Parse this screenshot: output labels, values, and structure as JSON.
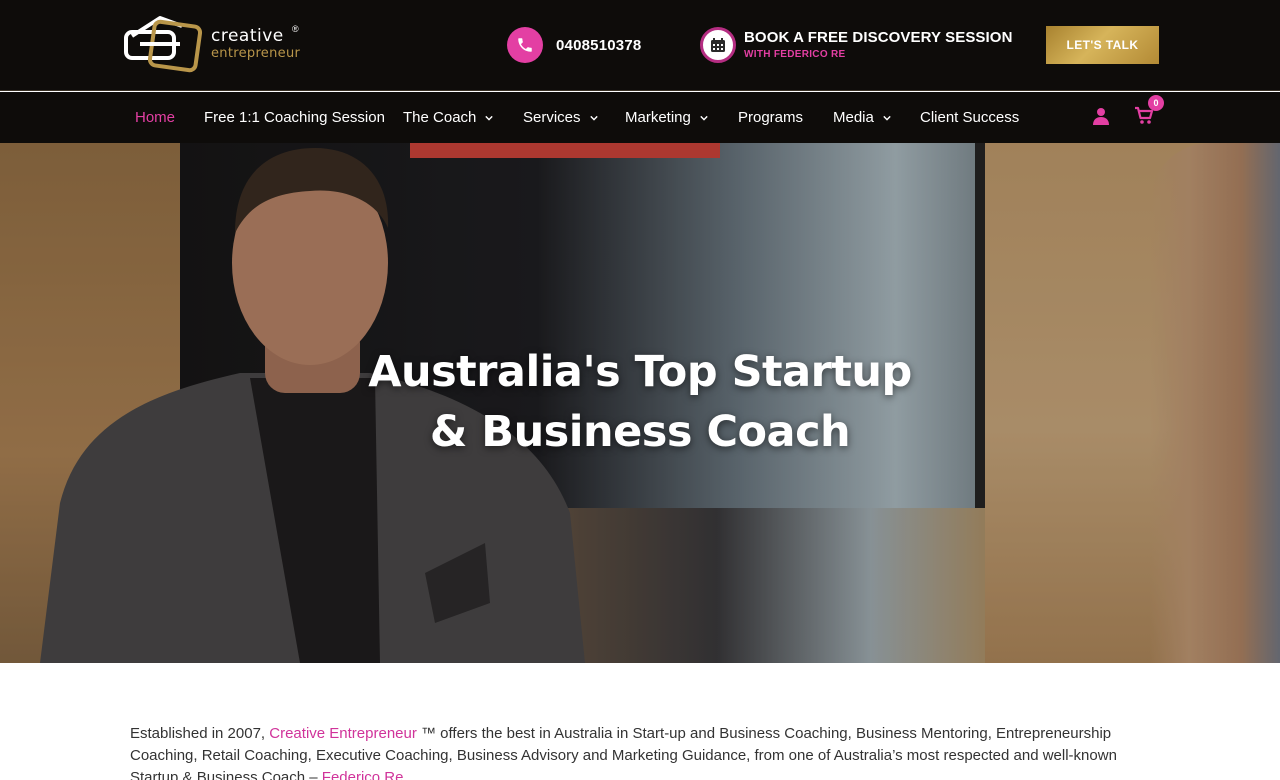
{
  "header": {
    "logo": {
      "word1": "creative",
      "word2": "entrepreneur",
      "reg": "®"
    },
    "phone": "0408510378",
    "book": {
      "title": "BOOK A FREE DISCOVERY SESSION",
      "subtitle": "WITH FEDERICO RE"
    },
    "cta": "LET'S TALK"
  },
  "nav": {
    "items": [
      {
        "label": "Home",
        "active": true
      },
      {
        "label": "Free 1:1 Coaching Session"
      },
      {
        "label": "The Coach",
        "dropdown": true
      },
      {
        "label": "Services",
        "dropdown": true
      },
      {
        "label": "Marketing",
        "dropdown": true
      },
      {
        "label": "Programs"
      },
      {
        "label": "Media",
        "dropdown": true
      },
      {
        "label": "Client Success"
      }
    ],
    "cart_count": "0"
  },
  "hero": {
    "title_line1": "Australia's Top Startup",
    "title_line2": "& Business Coach"
  },
  "intro": {
    "part1": "Established in 2007, ",
    "link1": "Creative Entrepreneur",
    "part2": " ™ offers the best in Australia in Start-up and Business Coaching, Business Mentoring, Entrepreneurship Coaching, Retail Coaching, Executive Coaching, Business Advisory and Marketing Guidance, from one of Australia’s most respected and well-known Startup & Business Coach – ",
    "link2": "Federico Re"
  },
  "colors": {
    "accent": "#e33fa3",
    "gold": "#b9964a",
    "header_bg": "#0e0c0a"
  }
}
